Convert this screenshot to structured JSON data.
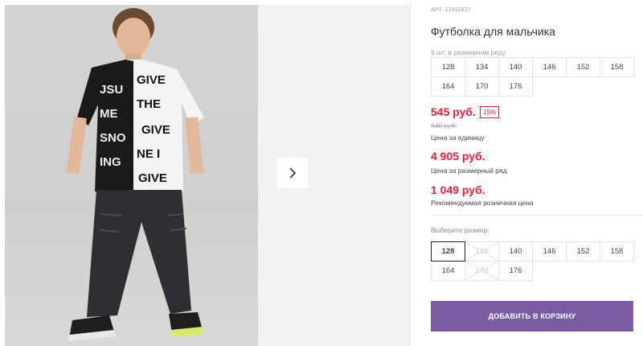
{
  "gallery": {
    "next_icon": "chevron-right-icon"
  },
  "product": {
    "article": "АРТ. 12411927",
    "title": "Футболка для мальчика",
    "series_note": "9 шт. в размерном ряду",
    "series_sizes": [
      "128",
      "134",
      "140",
      "146",
      "152",
      "158",
      "164",
      "170",
      "176"
    ],
    "price": "545 руб.",
    "discount": "15%",
    "old_price": "640 руб.",
    "price_caption": "Цена за единицу",
    "series_price": "4 905 руб.",
    "series_price_caption": "Цена за размерный ряд",
    "retail_price": "1 049 руб.",
    "retail_price_caption": "Рекомендуемая розничная цена",
    "choose_size_label": "Выберите размер:",
    "sizes": [
      {
        "label": "128",
        "state": "selected"
      },
      {
        "label": "134",
        "state": "disabled"
      },
      {
        "label": "140",
        "state": "available"
      },
      {
        "label": "146",
        "state": "available"
      },
      {
        "label": "152",
        "state": "available"
      },
      {
        "label": "158",
        "state": "available"
      },
      {
        "label": "164",
        "state": "available"
      },
      {
        "label": "170",
        "state": "disabled"
      },
      {
        "label": "176",
        "state": "available"
      }
    ],
    "add_to_cart": "ДОБАВИТЬ В КОРЗИНУ"
  },
  "colors": {
    "accent": "#7a5ca4",
    "price": "#e31e3c"
  }
}
